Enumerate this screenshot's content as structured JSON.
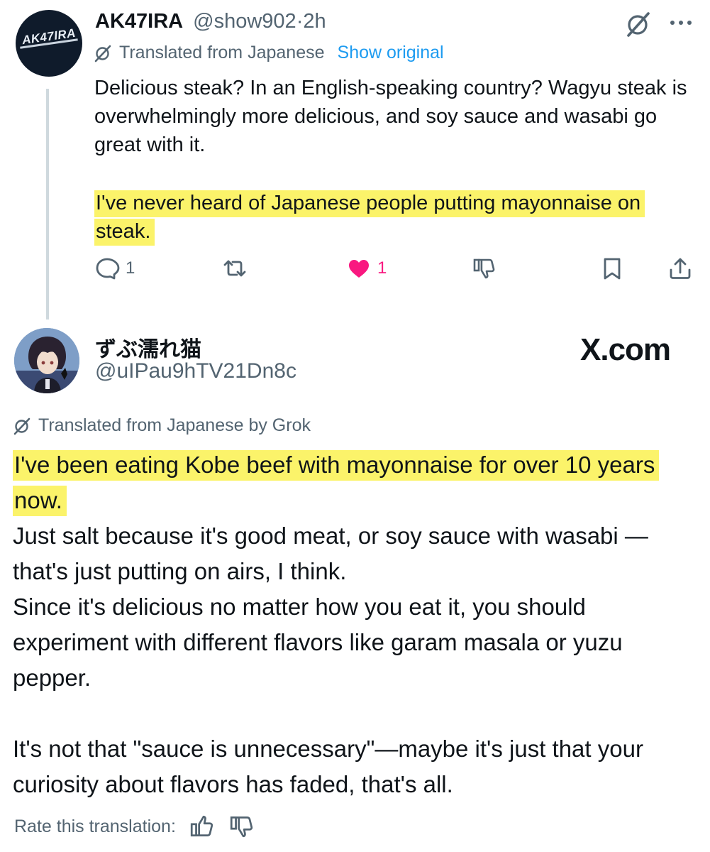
{
  "tweet1": {
    "display_name": "AK47IRA",
    "handle": "@show902",
    "separator": "·",
    "time": "2h",
    "avatar_text": "AK47IRA",
    "translated_label": "Translated from Japanese",
    "show_original_label": "Show original",
    "body_paragraph_1": "Delicious steak? In an English-speaking country? Wagyu steak is overwhelmingly more delicious, and soy sauce and wasabi go great with it.",
    "body_paragraph_2_highlighted": "I've never heard of Japanese people putting mayonnaise on steak.",
    "actions": {
      "reply_count": "1",
      "like_count": "1"
    }
  },
  "tweet2": {
    "display_name": "ずぶ濡れ猫",
    "handle": "@uIPau9hTV21Dn8c",
    "brand_label": "X.com",
    "translated_label": "Translated from Japanese by Grok",
    "body_highlighted": "I've been eating Kobe beef with mayonnaise for over 10 years now.",
    "body_lines_1": "Just salt because it's good meat, or soy sauce with wasabi —that's just putting on airs, I think.",
    "body_lines_2": "Since it's delicious no matter how you eat it, you should experiment with different flavors like garam masala or yuzu pepper.",
    "body_paragraph_3": "It's not that \"sauce is unnecessary\"—maybe it's just that your curiosity about flavors has faded, that's all.",
    "rate_label": "Rate this translation:"
  },
  "colors": {
    "highlight": "#fbf36a",
    "link_blue": "#1d9bf0",
    "like_pink": "#f91880",
    "secondary_text": "#536471"
  }
}
